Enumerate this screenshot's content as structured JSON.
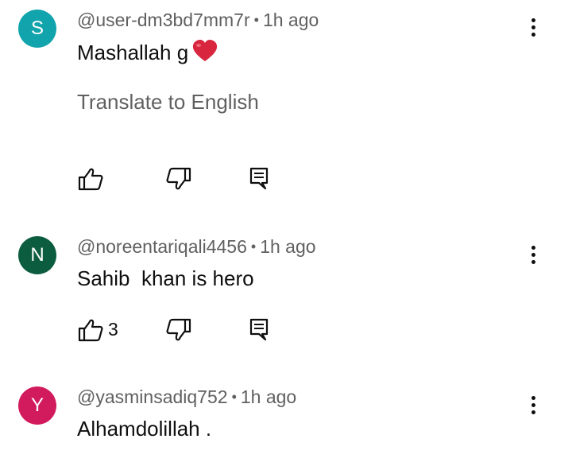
{
  "comments": [
    {
      "avatar_letter": "S",
      "avatar_color": "#12a4ad",
      "author": "@user-dm3bd7mm7r",
      "time": "1h ago",
      "text": "Mashallah g",
      "emoji": "red-heart",
      "translate_label": "Translate to English",
      "like_count": ""
    },
    {
      "avatar_letter": "N",
      "avatar_color": "#0c5d3f",
      "author": "@noreentariqali4456",
      "time": "1h ago",
      "text": "Sahib  khan is hero",
      "like_count": "3"
    },
    {
      "avatar_letter": "Y",
      "avatar_color": "#d21b5c",
      "author": "@yasminsadiq752",
      "time": "1h ago",
      "text": "Alhamdolillah ."
    }
  ],
  "separator": "•"
}
